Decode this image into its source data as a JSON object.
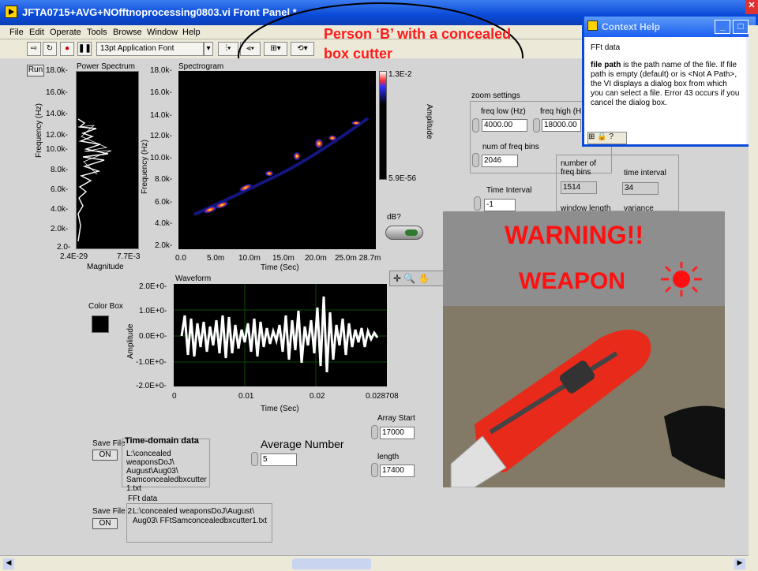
{
  "window": {
    "title": "JFTA0715+AVG+NOfftnoprocessing0803.vi Front Panel *"
  },
  "menu": [
    "File",
    "Edit",
    "Operate",
    "Tools",
    "Browse",
    "Window",
    "Help"
  ],
  "toolbar": {
    "font": "13pt Application Font"
  },
  "annotation": {
    "line1": "Person ‘B’ with a concealed",
    "line2": "box cutter"
  },
  "context_help": {
    "title": "Context Help",
    "heading": "FFt data",
    "body_bold": "file path",
    "body": " is the path name of the file. If file path is empty (default) or is <Not A Path>, the VI displays a dialog box from which you can select a file. Error 43 occurs if you cancel the dialog box."
  },
  "power_spectrum": {
    "run_label": "Run",
    "title": "Power Spectrum",
    "y_label": "Frequency (Hz)",
    "y_ticks": [
      "18.0k-",
      "16.0k-",
      "14.0k-",
      "12.0k-",
      "10.0k-",
      "8.0k-",
      "6.0k-",
      "4.0k-",
      "2.0k-",
      "2.0-"
    ],
    "x_ticks": [
      "2.4E-29",
      "7.7E-3"
    ],
    "x_label": "Magnitude"
  },
  "spectrogram": {
    "title": "Spectrogram",
    "y_label": "Frequency (Hz)",
    "y_ticks": [
      "18.0k-",
      "16.0k-",
      "14.0k-",
      "12.0k-",
      "10.0k-",
      "8.0k-",
      "6.0k-",
      "4.0k-",
      "2.0k-",
      "2.0-"
    ],
    "x_ticks": [
      "0.0",
      "5.0m",
      "10.0m",
      "15.0m",
      "20.0m",
      "25.0m 28.7m"
    ],
    "x_label": "Time (Sec)",
    "scale_max": "1.3E-2",
    "scale_min": "5.9E-56",
    "scale_label": "Amplitude"
  },
  "zoom": {
    "title": "zoom settings",
    "freq_low_label": "freq low (Hz)",
    "freq_low": "4000.00",
    "freq_high_label": "freq high (H",
    "freq_high": "18000.00",
    "bins_label": "num of freq bins",
    "bins": "2046",
    "time_interval_label": "Time Interval",
    "time_interval": "-1"
  },
  "info": {
    "nbins_label": "number of freq bins",
    "nbins": "1514",
    "tint_label": "time interval",
    "tint": "34",
    "window_label": "window length",
    "variance_label": "variance"
  },
  "db": {
    "label": "dB?"
  },
  "waveform": {
    "title": "Waveform",
    "y_label": "Amplitude",
    "y_ticks": [
      "2.0E+0-",
      "1.0E+0-",
      "0.0E+0-",
      "-1.0E+0-",
      "-2.0E+0-"
    ],
    "x_ticks": [
      "0",
      "0.01",
      "0.02",
      "0.028708"
    ],
    "x_label": "Time (Sec)"
  },
  "color_box": {
    "label": "Color Box"
  },
  "warning": {
    "line1": "WARNING!!",
    "line2": "WEAPON"
  },
  "time_domain": {
    "save_label": "Save File",
    "save_value": "ON",
    "title": "Time-domain data",
    "path": "L:\\concealed weaponsDoJ\\ August\\Aug03\\ Samconcealedbxcutter1.txt"
  },
  "fft_data": {
    "save_label": "Save File 2",
    "save_value": "ON",
    "title": "FFt data",
    "path": "L:\\concealed weaponsDoJ\\August\\ Aug03\\ FFtSamconcealedbxcutter1.txt"
  },
  "average": {
    "label": "Average Number",
    "value": "5"
  },
  "array": {
    "start_label": "Array Start",
    "start": "17000",
    "length_label": "length",
    "length": "17400"
  }
}
